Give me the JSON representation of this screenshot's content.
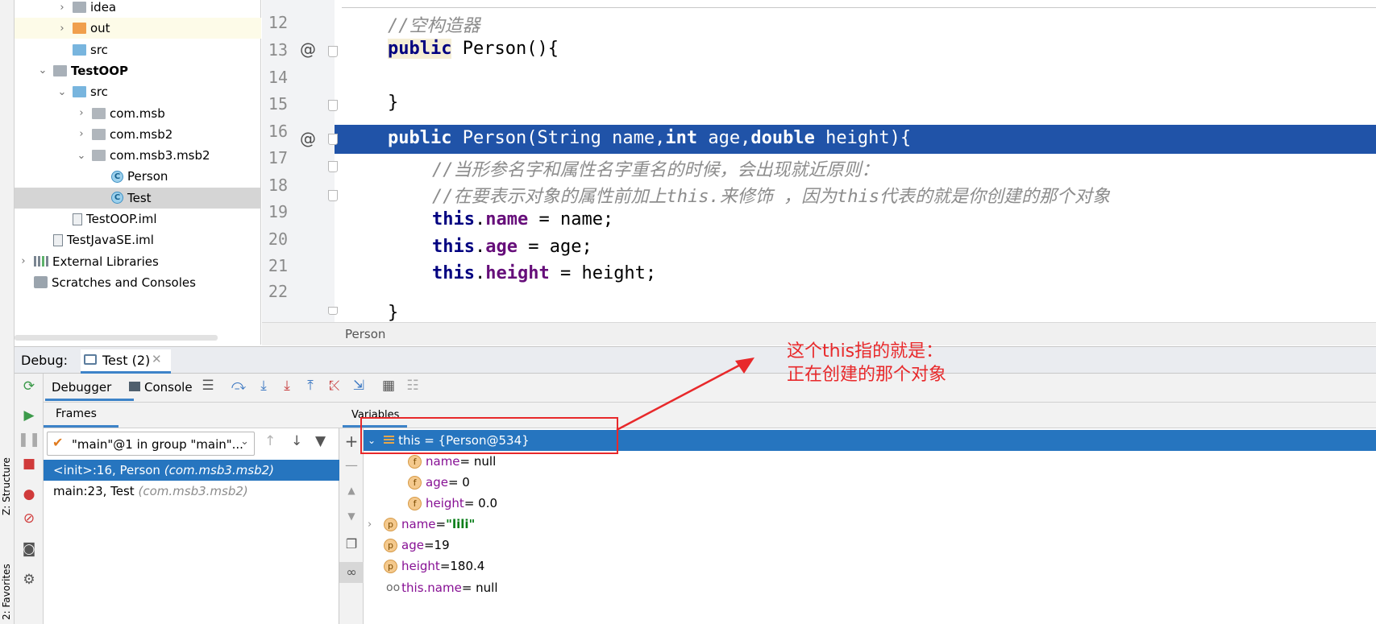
{
  "left_strip": {
    "structure_tab": "Z: Structure",
    "favorites_tab": "2: Favorites"
  },
  "project_tree": {
    "rows": [
      {
        "label": "idea",
        "indent": 3,
        "chevron": "›",
        "icon": "folder-grey"
      },
      {
        "label": "out",
        "indent": 3,
        "chevron": "›",
        "icon": "folder-orange"
      },
      {
        "label": "src",
        "indent": 3,
        "chevron": "",
        "icon": "folder-blue"
      },
      {
        "label": "TestOOP",
        "indent": 2,
        "chevron": "⌄",
        "icon": "module",
        "bold": true
      },
      {
        "label": "src",
        "indent": 3,
        "chevron": "⌄",
        "icon": "folder-blue"
      },
      {
        "label": "com.msb",
        "indent": 4,
        "chevron": "›",
        "icon": "package"
      },
      {
        "label": "com.msb2",
        "indent": 4,
        "chevron": "›",
        "icon": "package"
      },
      {
        "label": "com.msb3.msb2",
        "indent": 4,
        "chevron": "⌄",
        "icon": "package"
      },
      {
        "label": "Person",
        "indent": 5,
        "chevron": "",
        "icon": "class"
      },
      {
        "label": "Test",
        "indent": 5,
        "chevron": "",
        "icon": "class-run",
        "selected": true
      },
      {
        "label": "TestOOP.iml",
        "indent": 3,
        "chevron": "",
        "icon": "file"
      },
      {
        "label": "TestJavaSE.iml",
        "indent": 2,
        "chevron": "",
        "icon": "file"
      },
      {
        "label": "External Libraries",
        "indent": 1,
        "chevron": "›",
        "icon": "library"
      },
      {
        "label": "Scratches and Consoles",
        "indent": 1,
        "chevron": "",
        "icon": "scratches"
      }
    ]
  },
  "editor": {
    "line_numbers": [
      "12",
      "13",
      "14",
      "15",
      "16",
      "17",
      "18",
      "19",
      "20",
      "21",
      "22"
    ],
    "current_line": "16",
    "lines": {
      "l12": "//空构造器",
      "l13_kw": "public",
      "l13_rest": " Person(){",
      "l15": "}",
      "l16_a": "public",
      "l16_b": " Person(String name,",
      "l16_c": "int",
      "l16_d": " age,",
      "l16_e": "double",
      "l16_f": " height){",
      "l17": "//当形参名字和属性名字重名的时候，会出现就近原则：",
      "l18": "//在要表示对象的属性前加上this.来修饰 ，因为this代表的就是你创建的那个对象",
      "l19_this": "this",
      "l19_field": "name",
      "l19_rest": " = name;",
      "l20_this": "this",
      "l20_field": "age",
      "l20_rest": " = age;",
      "l21_this": "this",
      "l21_field": "height",
      "l21_rest": " = height;",
      "l22": "}"
    },
    "breadcrumb": "Person"
  },
  "debug": {
    "label": "Debug:",
    "session_tab": "Test (2)",
    "tabs": {
      "debugger": "Debugger",
      "console": "Console"
    },
    "frames_tab": "Frames",
    "variables_tab": "Variables",
    "thread_select": "\"main\"@1 in group \"main\"...",
    "frames": [
      {
        "method": "<init>:16, Person",
        "pkg": "(com.msb3.msb2)",
        "selected": true
      },
      {
        "method": "main:23, Test",
        "pkg": "(com.msb3.msb2)"
      }
    ],
    "variables": {
      "this_row": "this = {Person@534}",
      "fields": [
        {
          "badge": "f",
          "name": "name",
          "value": " = null"
        },
        {
          "badge": "f",
          "name": "age",
          "value": " = 0"
        },
        {
          "badge": "f",
          "name": "height",
          "value": " = 0.0"
        }
      ],
      "params": [
        {
          "badge": "p",
          "name": "name",
          "eq": " = ",
          "value": "\"lili\"",
          "is_string": true
        },
        {
          "badge": "p",
          "name": "age",
          "eq": " = ",
          "value": "19"
        },
        {
          "badge": "p",
          "name": "height",
          "eq": " = ",
          "value": "180.4"
        }
      ],
      "watch": {
        "name": "this.name",
        "value": " = null"
      }
    }
  },
  "annotation": {
    "text": "这个this指的就是：\n正在创建的那个对象",
    "color": "#e8292b"
  },
  "colors": {
    "selection": "#2675bf",
    "current_line": "#2053a8",
    "keyword": "#000080",
    "field": "#660e7a"
  }
}
